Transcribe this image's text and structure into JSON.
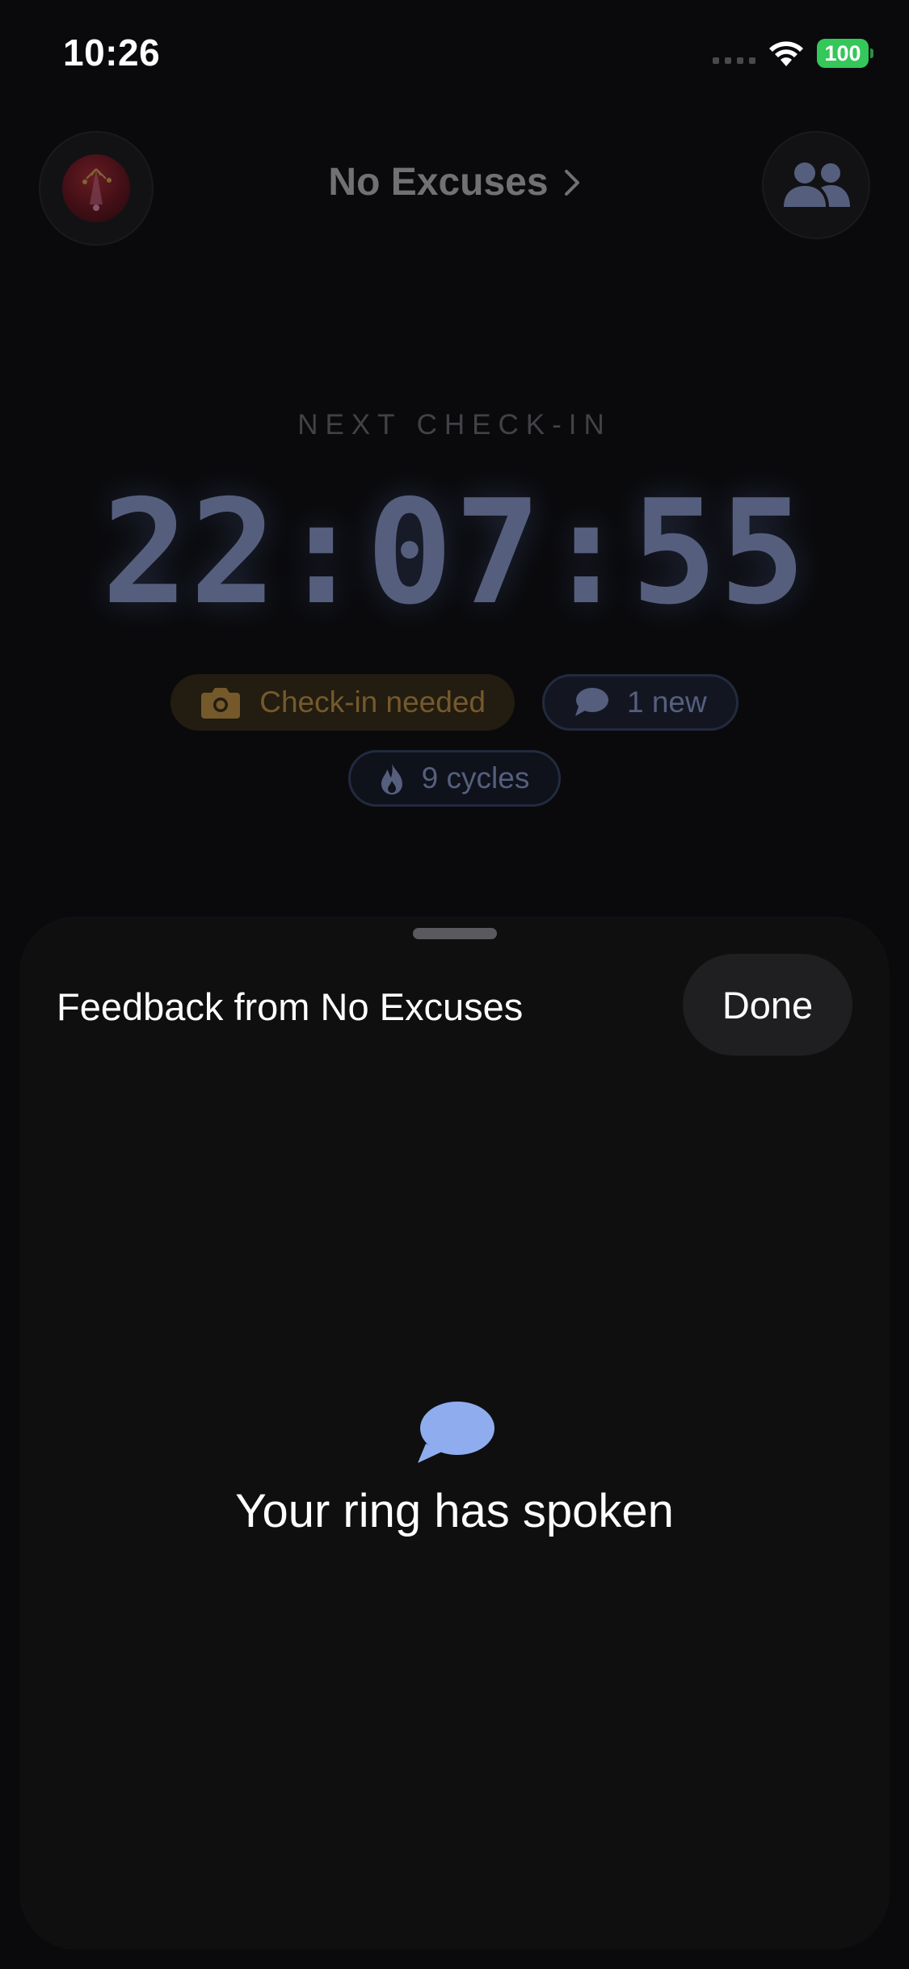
{
  "status_bar": {
    "time": "10:26",
    "battery": "100"
  },
  "header": {
    "group_name": "No Excuses",
    "chevron": "›"
  },
  "countdown": {
    "label": "NEXT CHECK-IN",
    "value": "22:07:55"
  },
  "chips": {
    "checkin": "Check-in needed",
    "new_messages": "1 new",
    "cycles": "9 cycles"
  },
  "sheet": {
    "title": "Feedback from No Excuses",
    "done_label": "Done",
    "empty_message": "Your ring has spoken"
  },
  "icons": {
    "wifi": "wifi-icon",
    "members": "group-icon",
    "camera": "camera-icon",
    "chat": "chat-bubble-icon",
    "flame": "flame-icon"
  },
  "colors": {
    "accent_blue": "#9fb4ee",
    "warning_orange": "#e0a84a",
    "battery_green": "#34c759"
  }
}
